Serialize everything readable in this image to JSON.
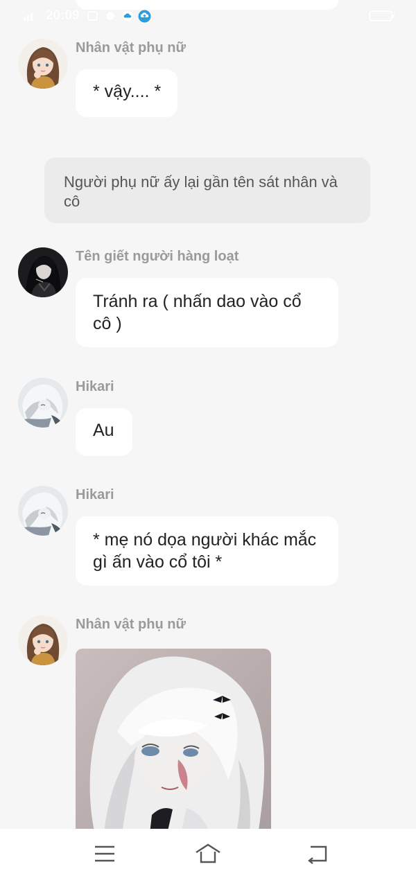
{
  "status_bar": {
    "time": "20:09"
  },
  "messages": [
    {
      "sender": "Nhân vật phụ nữ",
      "text": "* vậy.... *"
    },
    {
      "narration": "Người phụ nữ ấy lại gần tên sát nhân và cô"
    },
    {
      "sender": "Tên giết người hàng loạt",
      "text": "Tránh ra ( nhấn dao vào cổ cô )"
    },
    {
      "sender": "Hikari",
      "text": "Au"
    },
    {
      "sender": "Hikari",
      "text": "*  mẹ nó dọa người khác mắc gì ấn vào cổ tôi *"
    },
    {
      "sender": "Nhân vật phụ nữ",
      "image": "anime-white-haired-girl-image"
    }
  ],
  "nav_bar": {
    "menu_icon": "menu-icon",
    "home_icon": "home-icon",
    "back_icon": "back-icon"
  }
}
